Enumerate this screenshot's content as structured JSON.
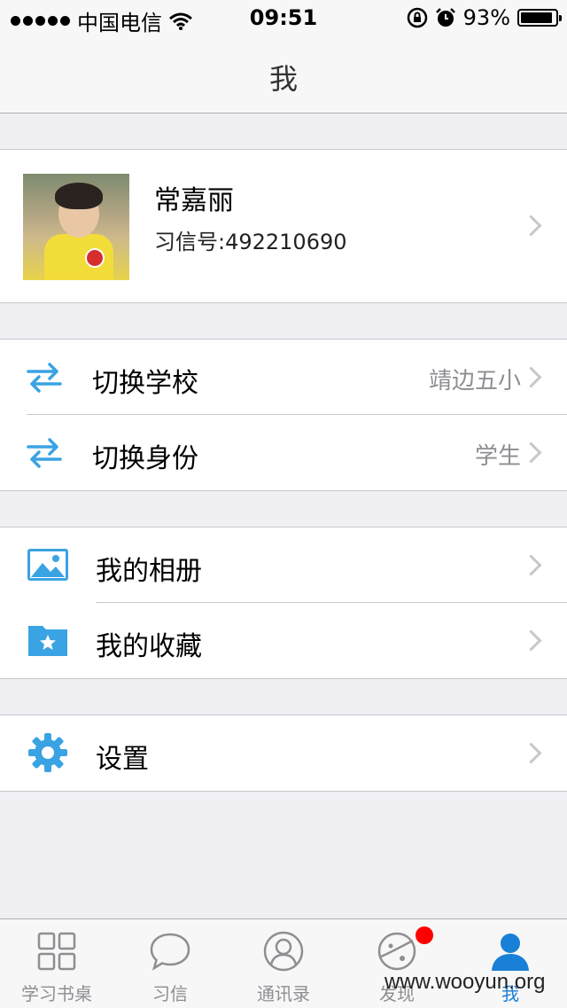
{
  "status_bar": {
    "carrier": "中国电信",
    "time": "09:51",
    "battery": "93%",
    "battery_level": 0.93,
    "icons": [
      "signal-dots-icon",
      "wifi-icon",
      "rotation-lock-icon",
      "alarm-icon",
      "battery-icon"
    ]
  },
  "nav": {
    "title": "我"
  },
  "profile": {
    "name": "常嘉丽",
    "id_label": "习信号:492210690"
  },
  "groups": {
    "switch": [
      {
        "label": "切换学校",
        "value": "靖边五小",
        "icon": "swap-arrows-icon"
      },
      {
        "label": "切换身份",
        "value": "学生",
        "icon": "swap-arrows-icon"
      }
    ],
    "personal": [
      {
        "label": "我的相册",
        "icon": "photo-album-icon"
      },
      {
        "label": "我的收藏",
        "icon": "favorites-folder-icon"
      }
    ],
    "settings": [
      {
        "label": "设置",
        "icon": "gear-icon"
      }
    ]
  },
  "tabbar": {
    "tabs": [
      {
        "label": "学习书桌",
        "icon": "grid-icon",
        "active": false
      },
      {
        "label": "习信",
        "icon": "chat-bubble-icon",
        "active": false
      },
      {
        "label": "通讯录",
        "icon": "contacts-icon",
        "active": false
      },
      {
        "label": "发现",
        "icon": "discover-planet-icon",
        "active": false,
        "badge": true
      },
      {
        "label": "我",
        "icon": "person-icon",
        "active": true
      }
    ]
  },
  "watermark": "www.wooyun.org",
  "colors": {
    "accent": "#1a7fd6",
    "icon_blue": "#3aa3e3",
    "badge_red": "#fe0000",
    "background": "#efeff4"
  }
}
